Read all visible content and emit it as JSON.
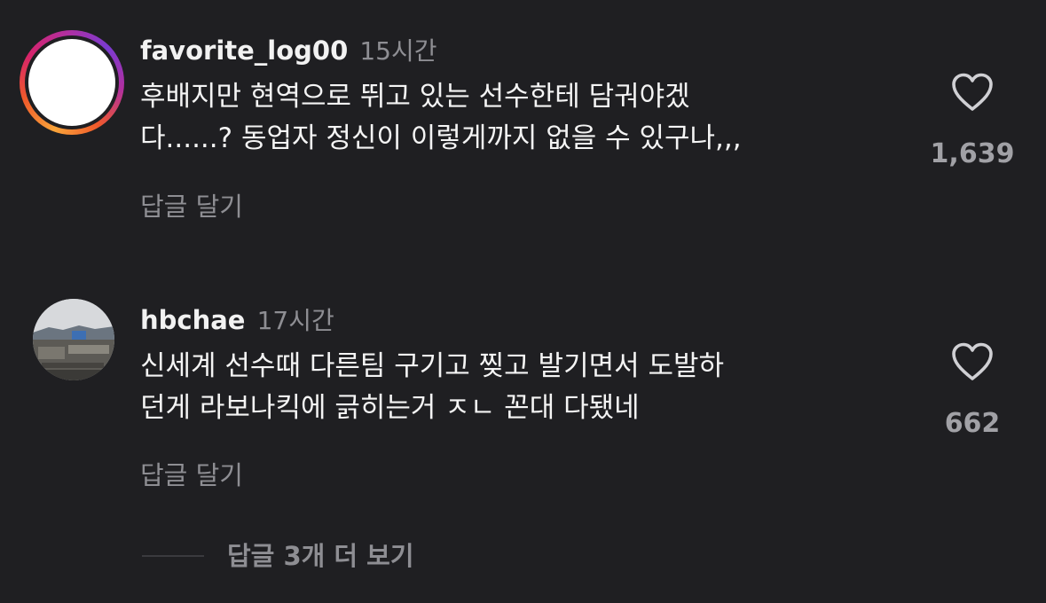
{
  "comments": [
    {
      "username": "favorite_log00",
      "time": "15시간",
      "text_lines": [
        "후배지만 현역으로 뛰고 있는 선수한테 담궈야겠",
        "다......? 동업자 정신이 이렇게까지 없을 수 있구나,,,"
      ],
      "likes": "1,639",
      "reply_label": "답글 달기",
      "avatar_icon": "profile-ring-avatar"
    },
    {
      "username": "hbchae",
      "time": "17시간",
      "text_lines": [
        "신세계 선수때 다른팀 구기고 찢고 발기면서 도발하",
        "던게 라보나킥에 긁히는거 ㅈㄴ 꼰대 다됐네"
      ],
      "likes": "662",
      "reply_label": "답글 달기",
      "avatar_icon": "photo-avatar"
    }
  ],
  "more_replies_label": "답글 3개 더 보기",
  "colors": {
    "background": "#1f1f22",
    "text": "#f4f4f4",
    "muted": "#8e8e93"
  }
}
